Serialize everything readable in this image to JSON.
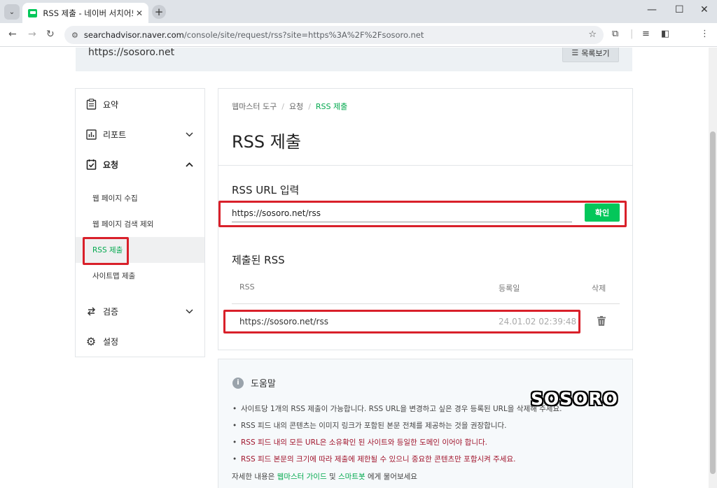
{
  "browser": {
    "tab_title": "RSS 제출 - 네이버 서치어드바이저",
    "tab_close": "✕",
    "new_tab": "+",
    "url_host": "searchadvisor.naver.com",
    "url_path": "/console/site/request/rss?site=https%3A%2F%2Fsosoro.net"
  },
  "site_bar": {
    "site_url": "https://sosoro.net",
    "list_button": "목록보기"
  },
  "sidebar": {
    "items": [
      {
        "label": "요약",
        "icon": "clipboard-icon"
      },
      {
        "label": "리포트",
        "icon": "chart-icon",
        "chevron": "⌄"
      },
      {
        "label": "요청",
        "icon": "checklist-icon",
        "chevron": "⌃"
      },
      {
        "label": "검증",
        "icon": "exchange-icon",
        "chevron": "⌄"
      },
      {
        "label": "설정",
        "icon": "gear-icon"
      }
    ],
    "sub_items": [
      {
        "label": "웹 페이지 수집"
      },
      {
        "label": "웹 페이지 검색 제외"
      },
      {
        "label": "RSS 제출"
      },
      {
        "label": "사이트맵 제출"
      }
    ]
  },
  "main": {
    "breadcrumb": [
      "웹마스터 도구",
      "요청",
      "RSS 제출"
    ],
    "breadcrumb_sep": "/",
    "title": "RSS 제출",
    "rss_input_title": "RSS URL 입력",
    "rss_input_value": "https://sosoro.net/rss",
    "confirm_button": "확인",
    "submitted_title": "제출된 RSS",
    "table": {
      "headers": [
        "RSS",
        "등록일",
        "삭제"
      ],
      "rows": [
        {
          "rss": "https://sosoro.net/rss",
          "date": "24.01.02 02:39:48"
        }
      ]
    }
  },
  "help": {
    "title": "도움말",
    "bullet": "•",
    "items": [
      {
        "text": "사이트당 1개의 RSS 제출이 가능합니다. RSS URL을 변경하고 싶은 경우 등록된 URL을 삭제해 주세요.",
        "red": false
      },
      {
        "text": "RSS 피드 내의 콘텐츠는 이미지 링크가 포함된 본문 전체를 제공하는 것을 권장합니다.",
        "red": false
      },
      {
        "text": "RSS 피드 내의 모든 URL은 소유확인 된 사이트와 등일한 도메인 이어야 합니다.",
        "red": true
      },
      {
        "text": "RSS 피드 본문의 크기에 따라 제출에 제한될 수 있으니 중요한 콘텐츠만 포함시켜 주세요.",
        "red": true
      }
    ],
    "footer_prefix": "자세한 내용은",
    "footer_link1": "웹마스터 가이드",
    "footer_mid": "및",
    "footer_link2": "스마트봇",
    "footer_suffix": "에게 물어보세요"
  },
  "watermark": "SOSORO",
  "colors": {
    "accent_green": "#03c75a",
    "highlight_red": "#d9202a"
  }
}
